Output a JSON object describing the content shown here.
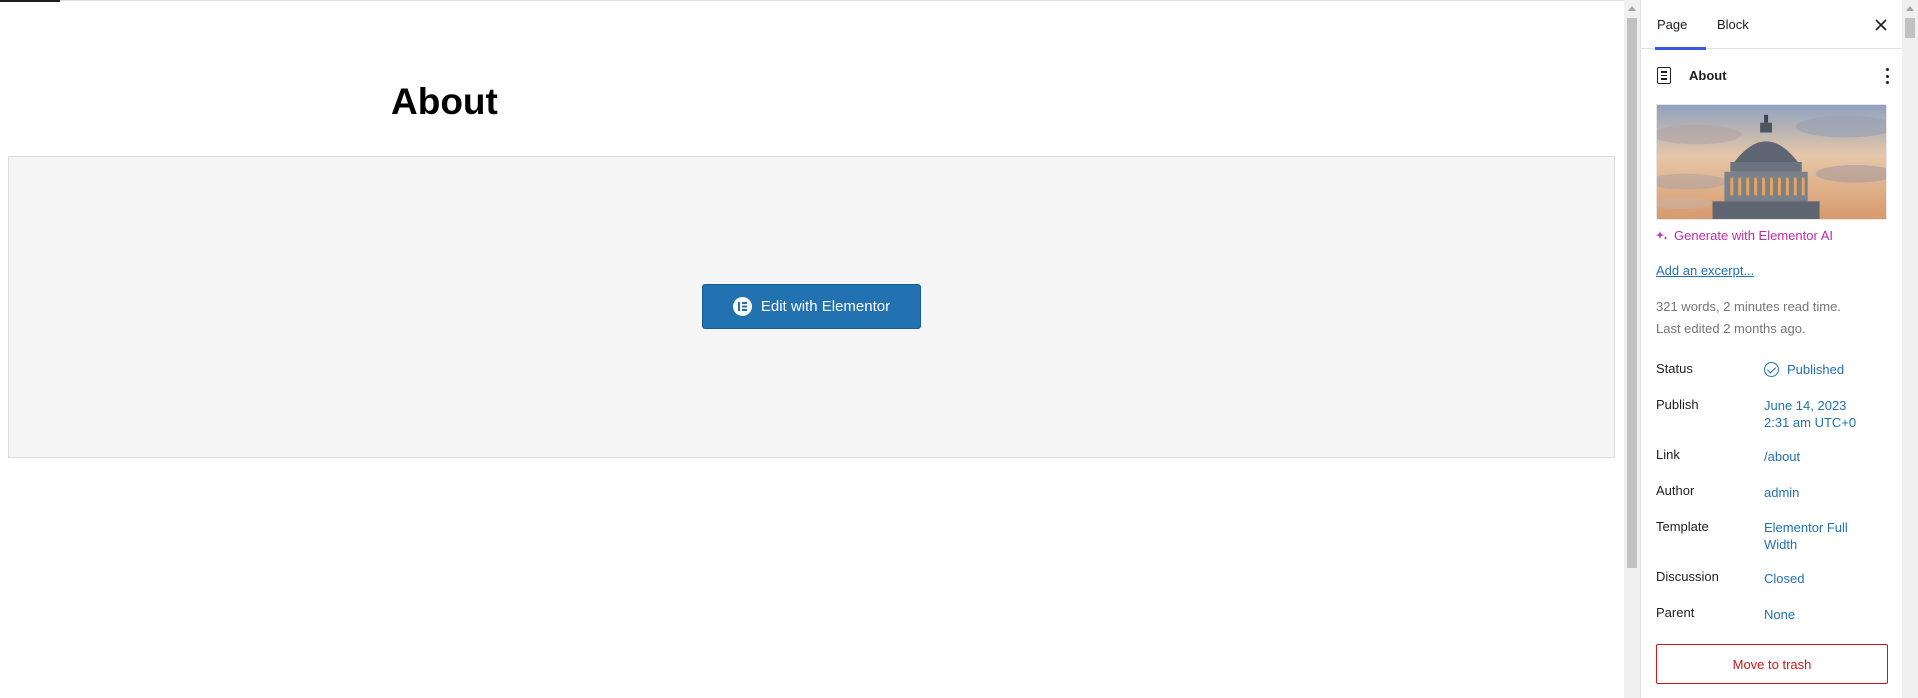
{
  "canvas": {
    "title": "About",
    "edit_button_label": "Edit with Elementor"
  },
  "sidebar": {
    "tabs": [
      {
        "label": "Page",
        "active": true
      },
      {
        "label": "Block",
        "active": false
      }
    ],
    "document_title": "About",
    "generate_ai_label": "Generate with Elementor AI",
    "excerpt_link": "Add an excerpt...",
    "meta_words": "321 words, 2 minutes read time.",
    "meta_edited": "Last edited 2 months ago.",
    "properties": {
      "status": {
        "label": "Status",
        "value": "Published"
      },
      "publish": {
        "label": "Publish",
        "value_date": "June 14, 2023",
        "value_time": "2:31 am UTC+0"
      },
      "link": {
        "label": "Link",
        "value": "/about"
      },
      "author": {
        "label": "Author",
        "value": "admin"
      },
      "template": {
        "label": "Template",
        "value_line1": "Elementor Full",
        "value_line2": "Width"
      },
      "discussion": {
        "label": "Discussion",
        "value": "Closed"
      },
      "parent": {
        "label": "Parent",
        "value": "None"
      }
    },
    "trash_label": "Move to trash"
  },
  "colors": {
    "accent": "#2271b1",
    "tab_indicator": "#3858e9",
    "ai": "#c02aa8",
    "danger": "#cc1818"
  }
}
